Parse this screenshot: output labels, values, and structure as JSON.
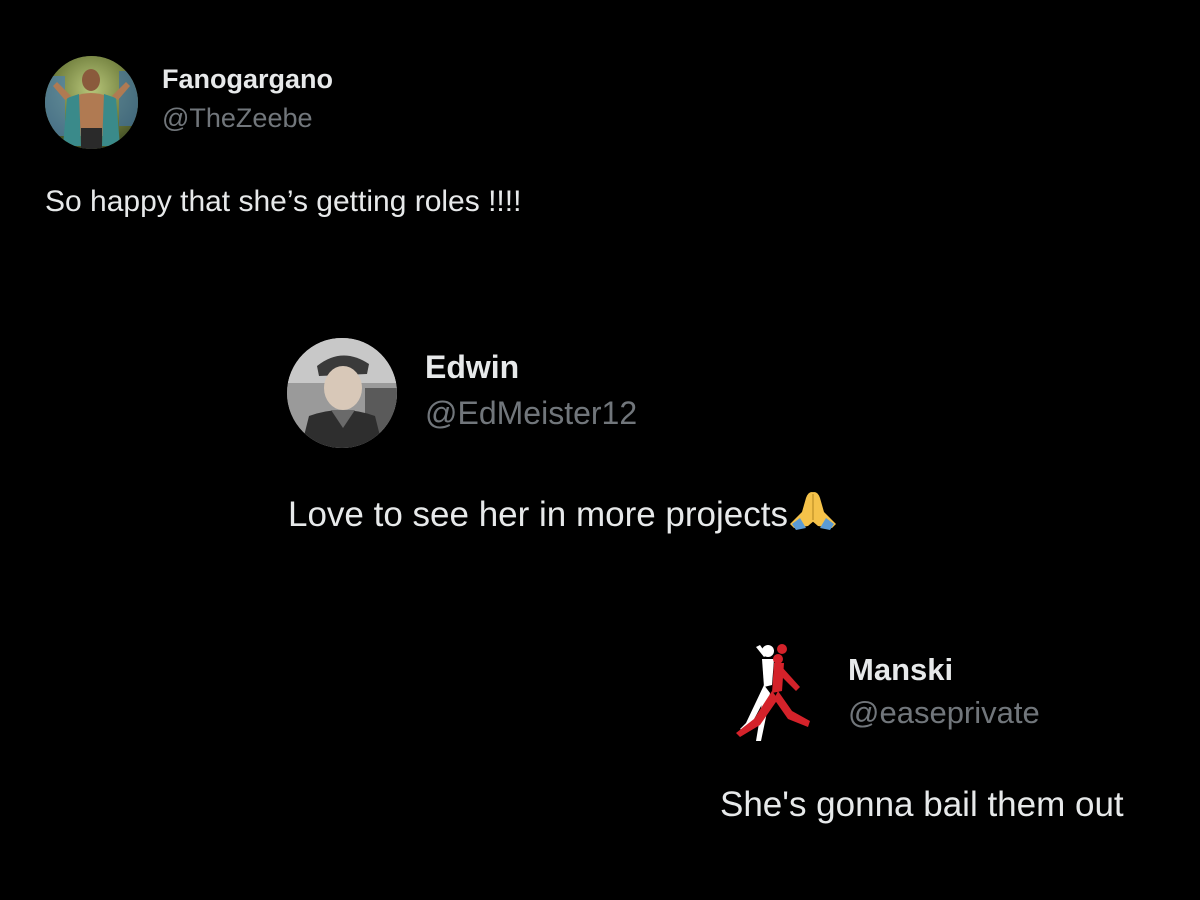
{
  "tweets": [
    {
      "name": "Fanogargano",
      "handle": "@TheZeebe",
      "text": "So happy that she’s getting roles !!!!",
      "avatar_icon": "wrestler-avatar"
    },
    {
      "name": "Edwin",
      "handle": "@EdMeister12",
      "text": "Love to see her in more projects",
      "emoji": "🙏",
      "avatar_icon": "man-with-cap-avatar"
    },
    {
      "name": "Manski",
      "handle": "@easeprivate",
      "text": "She's gonna bail them out",
      "avatar_icon": "jumpman-logo-avatar"
    }
  ],
  "colors": {
    "background": "#000000",
    "primary_text": "#e7e9ea",
    "secondary_text": "#71767b",
    "logo_red": "#d4222a"
  }
}
